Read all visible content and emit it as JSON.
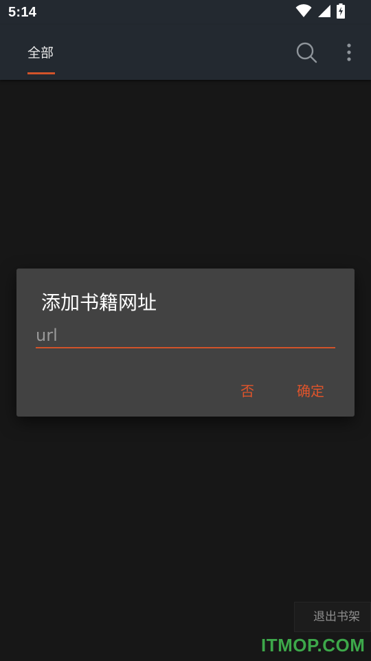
{
  "status_bar": {
    "time": "5:14",
    "icons": [
      "wifi-icon",
      "cell-signal-icon",
      "battery-charging-icon"
    ]
  },
  "app_bar": {
    "tab_label": "全部",
    "icons": [
      "search-icon",
      "more-vert-icon"
    ],
    "accent_color": "#d2532a"
  },
  "dialog": {
    "title": "添加书籍网址",
    "input": {
      "value": "",
      "placeholder": "url"
    },
    "buttons": {
      "negative_label": "否",
      "positive_label": "确定"
    },
    "button_color": "#e0542b"
  },
  "bottom": {
    "exit_shelf_label": "退出书架"
  },
  "watermark": {
    "text": "ITMOP.COM",
    "color": "#3da84a"
  }
}
